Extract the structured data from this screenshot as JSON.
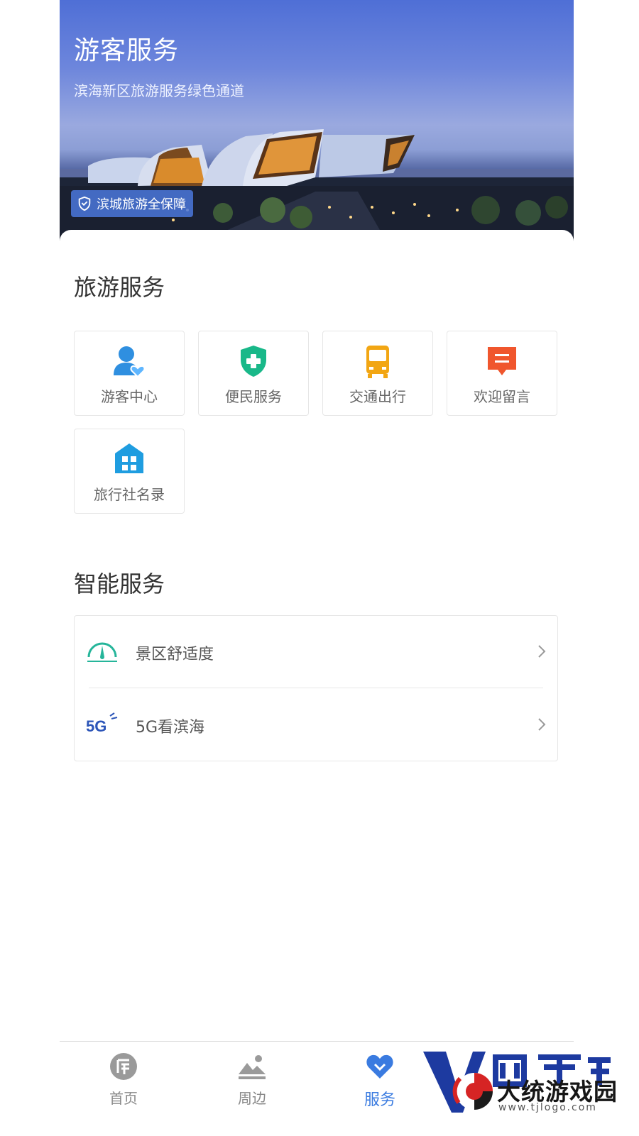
{
  "hero": {
    "title": "游客服务",
    "subtitle": "滨海新区旅游服务绿色通道",
    "badge": "滨城旅游全保障"
  },
  "tourism_section": {
    "title": "旅游服务",
    "items": [
      {
        "label": "游客中心",
        "icon": "user-heart-icon",
        "color": "#2f8fe0"
      },
      {
        "label": "便民服务",
        "icon": "shield-plus-icon",
        "color": "#19b889"
      },
      {
        "label": "交通出行",
        "icon": "bus-icon",
        "color": "#f2a613"
      },
      {
        "label": "欢迎留言",
        "icon": "message-icon",
        "color": "#f0562d"
      },
      {
        "label": "旅行社名录",
        "icon": "building-icon",
        "color": "#1f9de0"
      }
    ]
  },
  "smart_section": {
    "title": "智能服务",
    "items": [
      {
        "label": "景区舒适度",
        "icon": "gauge-icon",
        "color": "#25b59a"
      },
      {
        "label": "5G看滨海",
        "icon": "5g-icon",
        "color": "#2c55b8"
      }
    ]
  },
  "tabbar": {
    "items": [
      {
        "label": "首页",
        "icon": "home-logo-icon",
        "active": false
      },
      {
        "label": "周边",
        "icon": "landscape-icon",
        "active": false
      },
      {
        "label": "服务",
        "icon": "heart-icon",
        "active": true
      }
    ],
    "active_color": "#3a7be0"
  },
  "watermark": {
    "brand": "大统游戏园",
    "url": "www.tjlogo.com"
  }
}
